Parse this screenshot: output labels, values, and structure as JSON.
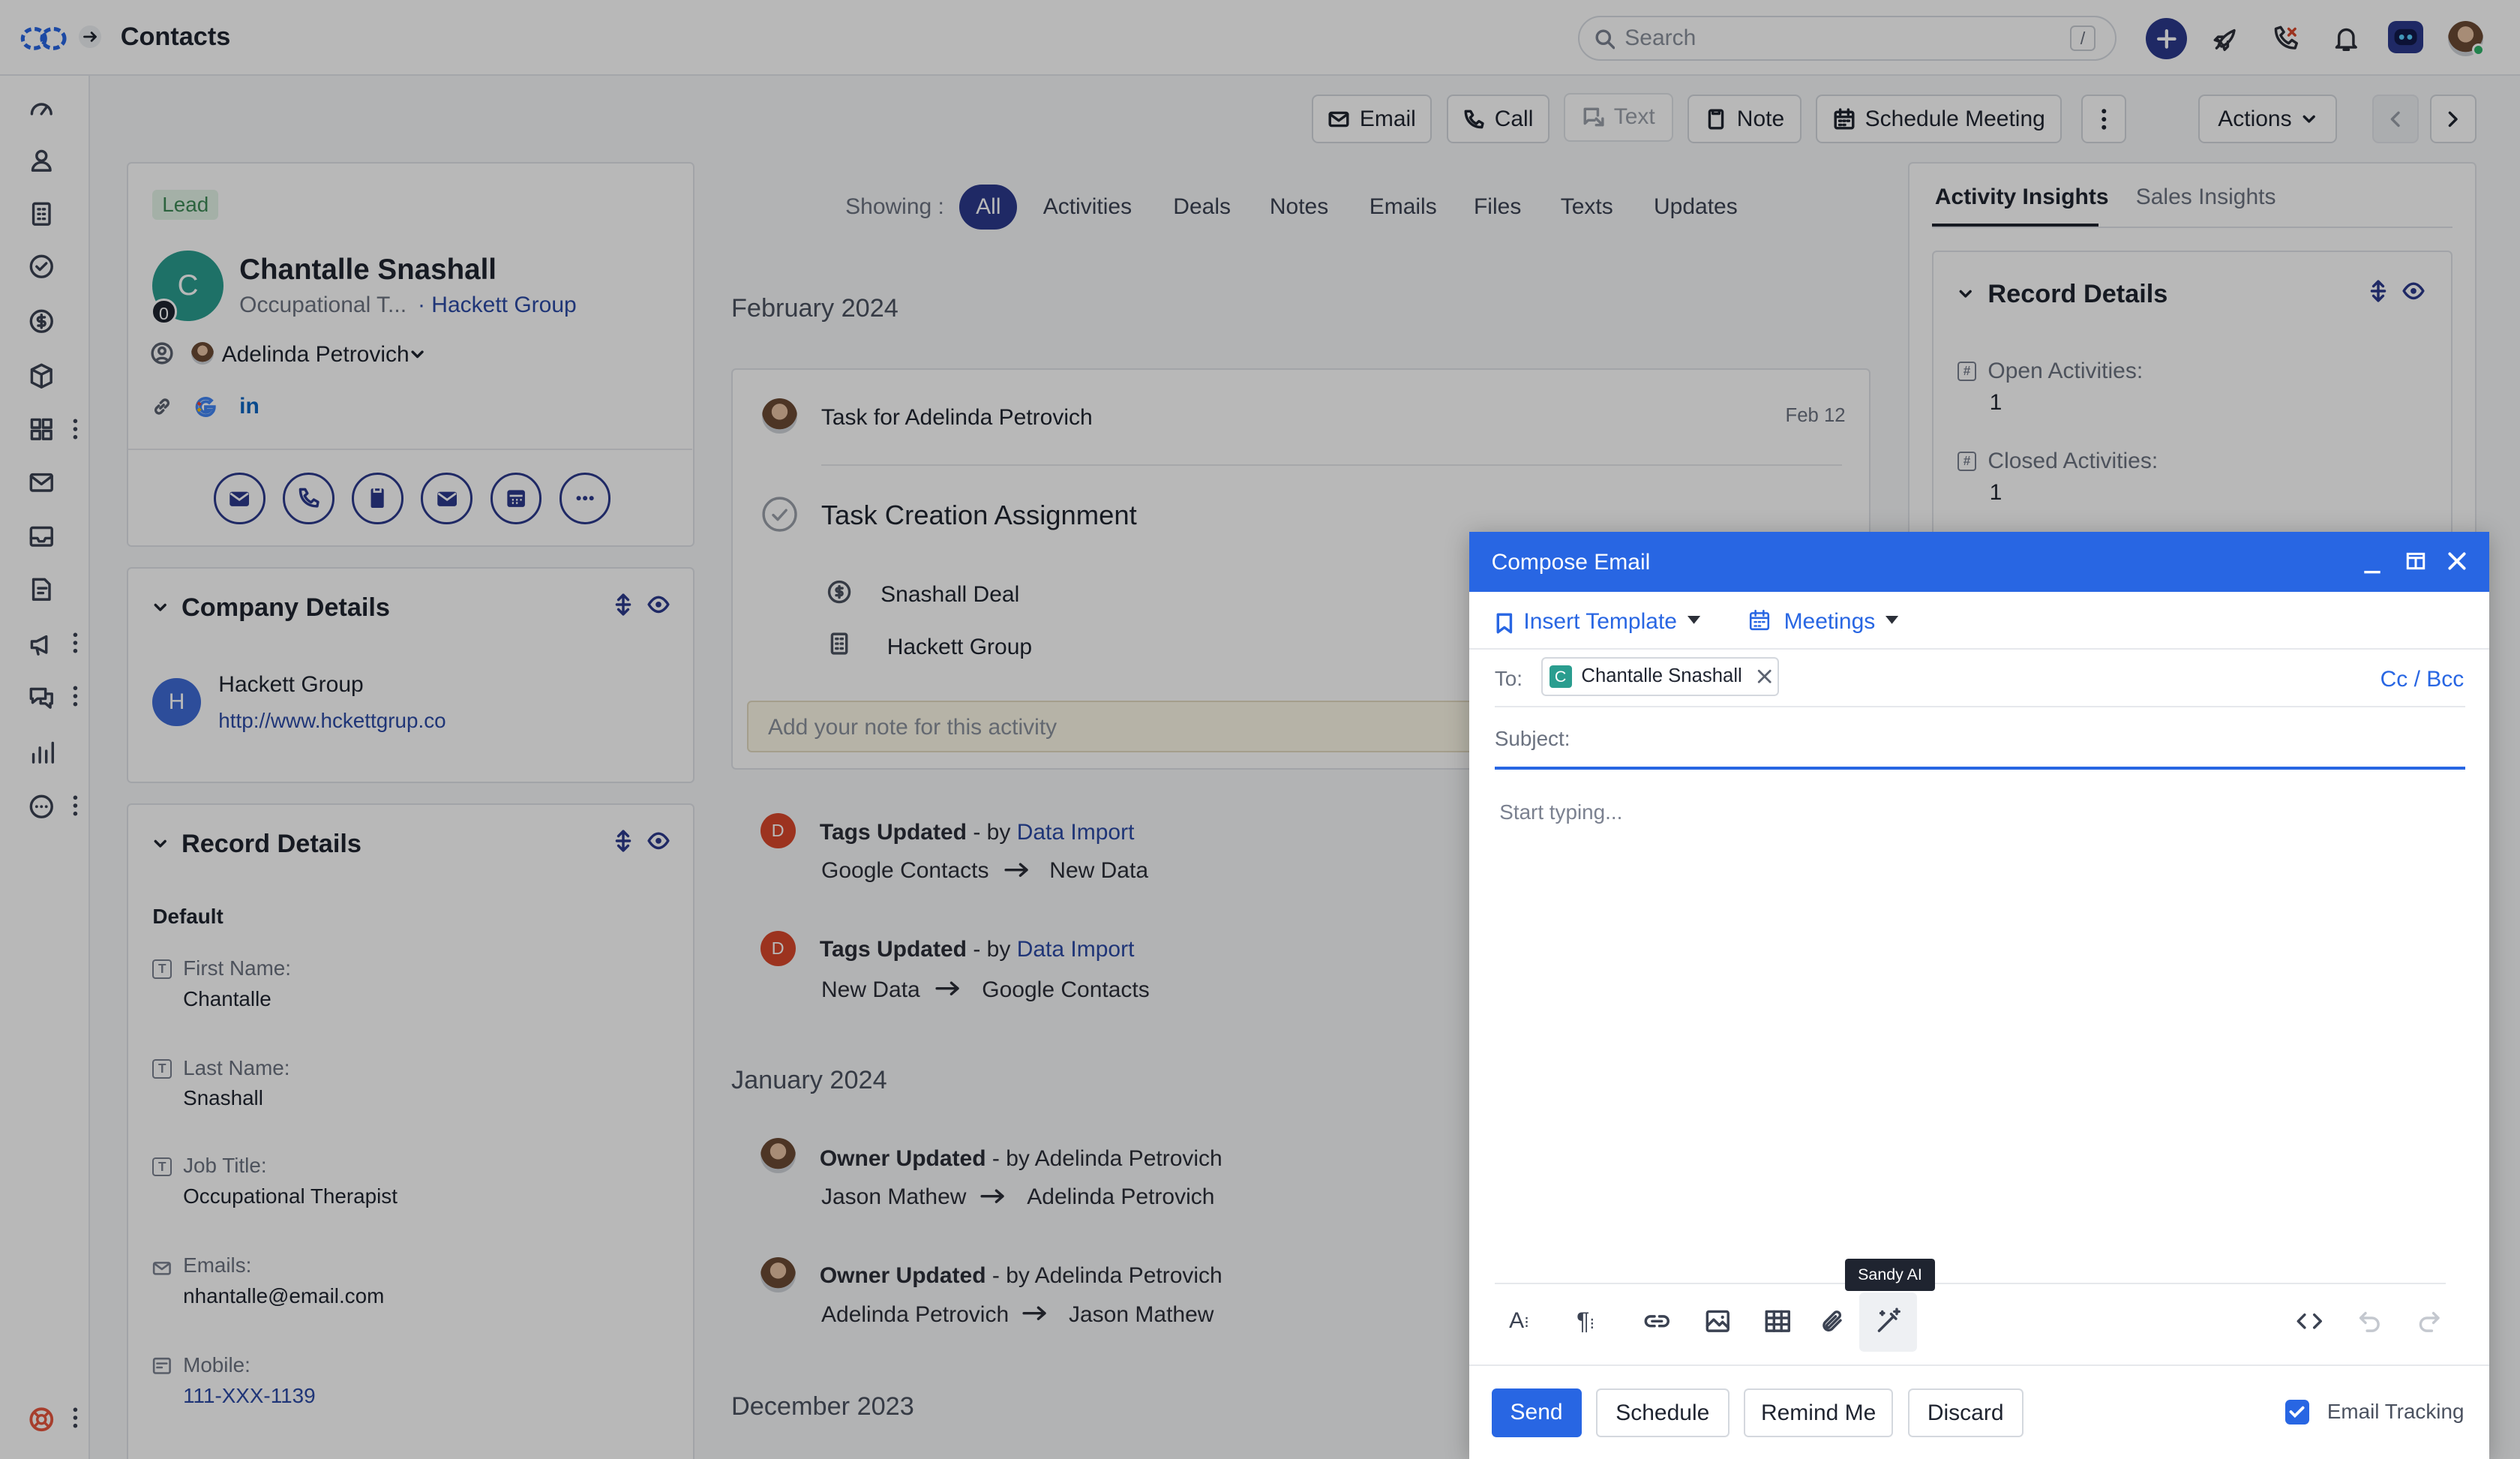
{
  "app": {
    "title": "Contacts",
    "search_placeholder": "Search",
    "search_shortcut": "/"
  },
  "toolbar": {
    "email": "Email",
    "call": "Call",
    "text": "Text",
    "note": "Note",
    "schedule_meeting": "Schedule Meeting",
    "actions": "Actions"
  },
  "contact": {
    "badge": "Lead",
    "initial": "C",
    "count_badge": "0",
    "name": "Chantalle Snashall",
    "title": "Occupational T...",
    "company_link": "· Hackett Group",
    "owner": "Adelinda Petrovich"
  },
  "company": {
    "header": "Company Details",
    "initial": "H",
    "name": "Hackett Group",
    "url": "http://www.hckettgrup.co"
  },
  "record_left": {
    "header": "Record Details",
    "section": "Default",
    "fields": [
      {
        "label": "First Name:",
        "value": "Chantalle"
      },
      {
        "label": "Last Name:",
        "value": "Snashall"
      },
      {
        "label": "Job Title:",
        "value": "Occupational Therapist"
      },
      {
        "label": "Emails:",
        "value": "nhantalle@email.com"
      },
      {
        "label": "Mobile:",
        "value": "111-XXX-1139"
      }
    ]
  },
  "filters": {
    "showing": "Showing :",
    "items": [
      "All",
      "Activities",
      "Deals",
      "Notes",
      "Emails",
      "Files",
      "Texts",
      "Updates"
    ],
    "active": "All"
  },
  "timeline": {
    "feb": "February 2024",
    "jan": "January 2024",
    "dec": "December 2023",
    "task": {
      "prefix": "Task",
      "for_text": "for Adelinda Petrovich",
      "date": "Feb 12",
      "title": "Task Creation Assignment",
      "deal": "Snashall Deal",
      "company": "Hackett Group",
      "note_placeholder": "Add your note for this activity"
    },
    "updates": [
      {
        "title": "Tags Updated",
        "by": "- by",
        "who": "Data Import",
        "from": "Google Contacts",
        "to": "New Data",
        "avatar": "D"
      },
      {
        "title": "Tags Updated",
        "by": "- by",
        "who": "Data Import",
        "from": "New Data",
        "to": "Google Contacts",
        "avatar": "D"
      },
      {
        "title": "Owner Updated",
        "by": "- by Adelinda Petrovich",
        "from": "Jason Mathew",
        "to": "Adelinda Petrovich"
      },
      {
        "title": "Owner Updated",
        "by": "- by Adelinda Petrovich",
        "from": "Adelinda Petrovich",
        "to": "Jason Mathew"
      }
    ]
  },
  "insights": {
    "tab_activity": "Activity Insights",
    "tab_sales": "Sales Insights",
    "header": "Record Details",
    "open_label": "Open Activities:",
    "open_value": "1",
    "closed_label": "Closed Activities:",
    "closed_value": "1"
  },
  "compose": {
    "title": "Compose Email",
    "insert_template": "Insert Template",
    "meetings": "Meetings",
    "to_label": "To:",
    "recipient_initial": "C",
    "recipient": "Chantalle Snashall",
    "cc_bcc": "Cc / Bcc",
    "subject_label": "Subject:",
    "body_placeholder": "Start typing...",
    "tooltip": "Sandy AI",
    "send": "Send",
    "schedule": "Schedule",
    "remind_me": "Remind Me",
    "discard": "Discard",
    "email_tracking": "Email Tracking"
  },
  "colors": {
    "primary": "#2866e3",
    "navy": "#2b3a8c",
    "lead_bg": "#e3f4e8",
    "lead_fg": "#3d8a56",
    "teal": "#2a9d8f",
    "red_avatar": "#d9472b"
  }
}
